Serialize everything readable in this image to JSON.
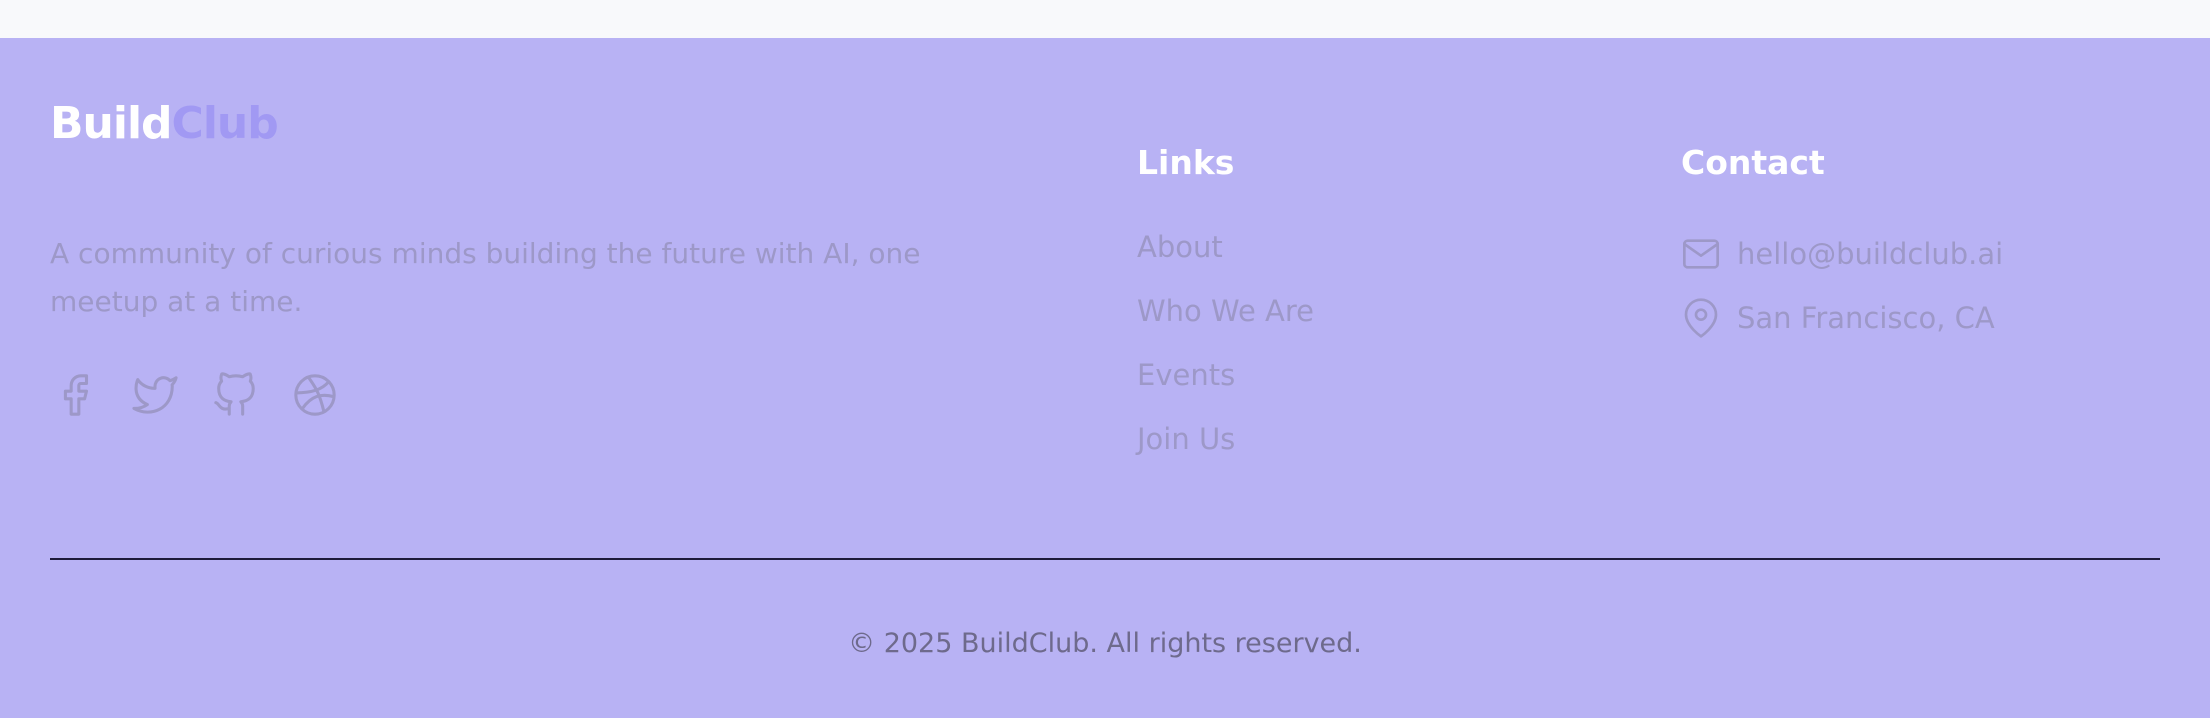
{
  "brand": {
    "name_part1": "Build",
    "name_part2": "Club",
    "tagline": "A community of curious minds building the future with AI, one meetup at a time.",
    "colors": {
      "part1": "#ffffff",
      "part2": "#a199f3"
    }
  },
  "social": [
    {
      "icon": "facebook-icon"
    },
    {
      "icon": "twitter-icon"
    },
    {
      "icon": "github-icon"
    },
    {
      "icon": "dribbble-icon"
    }
  ],
  "links": {
    "title": "Links",
    "items": [
      "About",
      "Who We Are",
      "Events",
      "Join Us"
    ]
  },
  "contact": {
    "title": "Contact",
    "email": "hello@buildclub.ai",
    "location": "San Francisco, CA",
    "email_icon": "mail-icon",
    "location_icon": "map-pin-icon"
  },
  "footer": {
    "copyright": "© 2025 BuildClub. All rights reserved.",
    "background": "#b8b2f4"
  }
}
